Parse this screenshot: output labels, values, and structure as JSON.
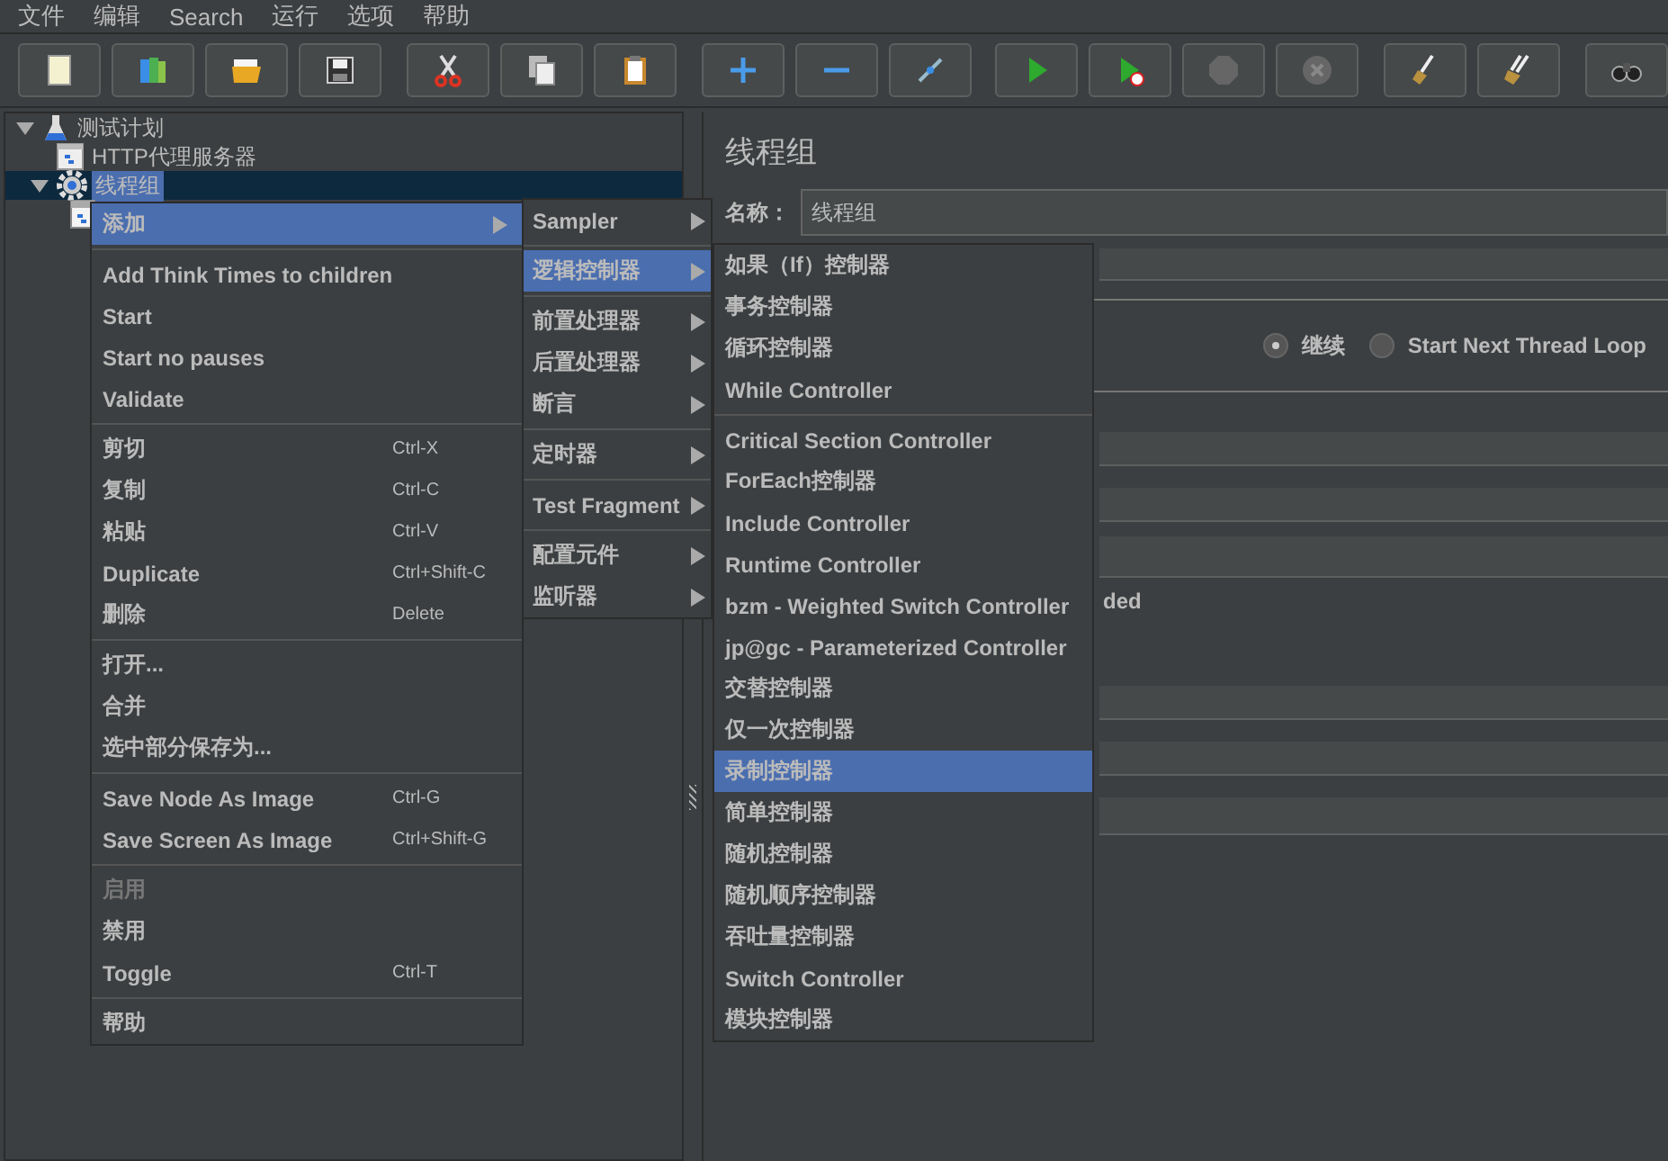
{
  "menu_bar": [
    "文件",
    "编辑",
    "Search",
    "运行",
    "选项",
    "帮助"
  ],
  "tree": [
    {
      "label": "测试计划",
      "kind": "test-plan",
      "selected": false,
      "expanded": true,
      "children": [
        {
          "label": "HTTP代理服务器",
          "kind": "proxy",
          "selected": false
        },
        {
          "label": "线程组",
          "kind": "thread-group",
          "selected": true,
          "expanded": true,
          "children": [
            {
              "kind": "element",
              "selected": false
            }
          ]
        }
      ]
    }
  ],
  "context_menu": {
    "groups": [
      [
        {
          "label": "添加",
          "selected": true,
          "disabled": false,
          "submenu": true
        }
      ],
      [
        {
          "label": "Add Think Times to children",
          "selected": false,
          "disabled": false,
          "submenu": false
        },
        {
          "label": "Start",
          "selected": false,
          "disabled": false,
          "submenu": false
        },
        {
          "label": "Start no pauses",
          "selected": false,
          "disabled": false,
          "submenu": false
        },
        {
          "label": "Validate",
          "selected": false,
          "disabled": false,
          "submenu": false
        }
      ],
      [
        {
          "label": "剪切",
          "shortcut": "Ctrl-X",
          "selected": false,
          "disabled": false,
          "submenu": false
        },
        {
          "label": "复制",
          "shortcut": "Ctrl-C",
          "selected": false,
          "disabled": false,
          "submenu": false
        },
        {
          "label": "粘贴",
          "shortcut": "Ctrl-V",
          "selected": false,
          "disabled": false,
          "submenu": false
        },
        {
          "label": "Duplicate",
          "shortcut": "Ctrl+Shift-C",
          "selected": false,
          "disabled": false,
          "submenu": false
        },
        {
          "label": "删除",
          "shortcut": "Delete",
          "selected": false,
          "disabled": false,
          "submenu": false
        }
      ],
      [
        {
          "label": "打开...",
          "selected": false,
          "disabled": false,
          "submenu": false
        },
        {
          "label": "合并",
          "selected": false,
          "disabled": false,
          "submenu": false
        },
        {
          "label": "选中部分保存为...",
          "selected": false,
          "disabled": false,
          "submenu": false
        }
      ],
      [
        {
          "label": "Save Node As Image",
          "shortcut": "Ctrl-G",
          "selected": false,
          "disabled": false,
          "submenu": false
        },
        {
          "label": "Save Screen As Image",
          "shortcut": "Ctrl+Shift-G",
          "selected": false,
          "disabled": false,
          "submenu": false
        }
      ],
      [
        {
          "label": "启用",
          "selected": false,
          "disabled": true,
          "submenu": false
        },
        {
          "label": "禁用",
          "selected": false,
          "disabled": false,
          "submenu": false
        },
        {
          "label": "Toggle",
          "shortcut": "Ctrl-T",
          "selected": false,
          "disabled": false,
          "submenu": false
        }
      ],
      [
        {
          "label": "帮助",
          "selected": false,
          "disabled": false,
          "submenu": false
        }
      ]
    ]
  },
  "add_submenu": {
    "groups": [
      [
        {
          "label": "Sampler",
          "selected": false,
          "submenu": true
        }
      ],
      [
        {
          "label": "逻辑控制器",
          "selected": true,
          "submenu": true
        }
      ],
      [
        {
          "label": "前置处理器",
          "selected": false,
          "submenu": true
        },
        {
          "label": "后置处理器",
          "selected": false,
          "submenu": true
        },
        {
          "label": "断言",
          "selected": false,
          "submenu": true
        }
      ],
      [
        {
          "label": "定时器",
          "selected": false,
          "submenu": true
        }
      ],
      [
        {
          "label": "Test Fragment",
          "selected": false,
          "submenu": true
        }
      ],
      [
        {
          "label": "配置元件",
          "selected": false,
          "submenu": true
        },
        {
          "label": "监听器",
          "selected": false,
          "submenu": true
        }
      ]
    ]
  },
  "controller_submenu": {
    "groups": [
      [
        {
          "label": "如果（If）控制器",
          "selected": false
        },
        {
          "label": "事务控制器",
          "selected": false
        },
        {
          "label": "循环控制器",
          "selected": false
        },
        {
          "label": "While Controller",
          "selected": false
        }
      ],
      [
        {
          "label": "Critical Section Controller",
          "selected": false
        },
        {
          "label": "ForEach控制器",
          "selected": false
        },
        {
          "label": "Include Controller",
          "selected": false
        },
        {
          "label": "Runtime Controller",
          "selected": false
        },
        {
          "label": "bzm - Weighted Switch Controller",
          "selected": false
        },
        {
          "label": "jp@gc - Parameterized Controller",
          "selected": false
        },
        {
          "label": "交替控制器",
          "selected": false
        },
        {
          "label": "仅一次控制器",
          "selected": false
        },
        {
          "label": "录制控制器",
          "selected": true
        },
        {
          "label": "简单控制器",
          "selected": false
        },
        {
          "label": "随机控制器",
          "selected": false
        },
        {
          "label": "随机顺序控制器",
          "selected": false
        },
        {
          "label": "吞吐量控制器",
          "selected": false
        },
        {
          "label": "Switch Controller",
          "selected": false
        },
        {
          "label": "模块控制器",
          "selected": false
        }
      ]
    ]
  },
  "panel": {
    "title": "线程组",
    "name_label": "名称：",
    "name_value": "线程组",
    "on_error": [
      {
        "label": "继续",
        "selected": true
      },
      {
        "label": "Start Next Thread Loop",
        "selected": false
      }
    ],
    "partial_text": "ded"
  }
}
